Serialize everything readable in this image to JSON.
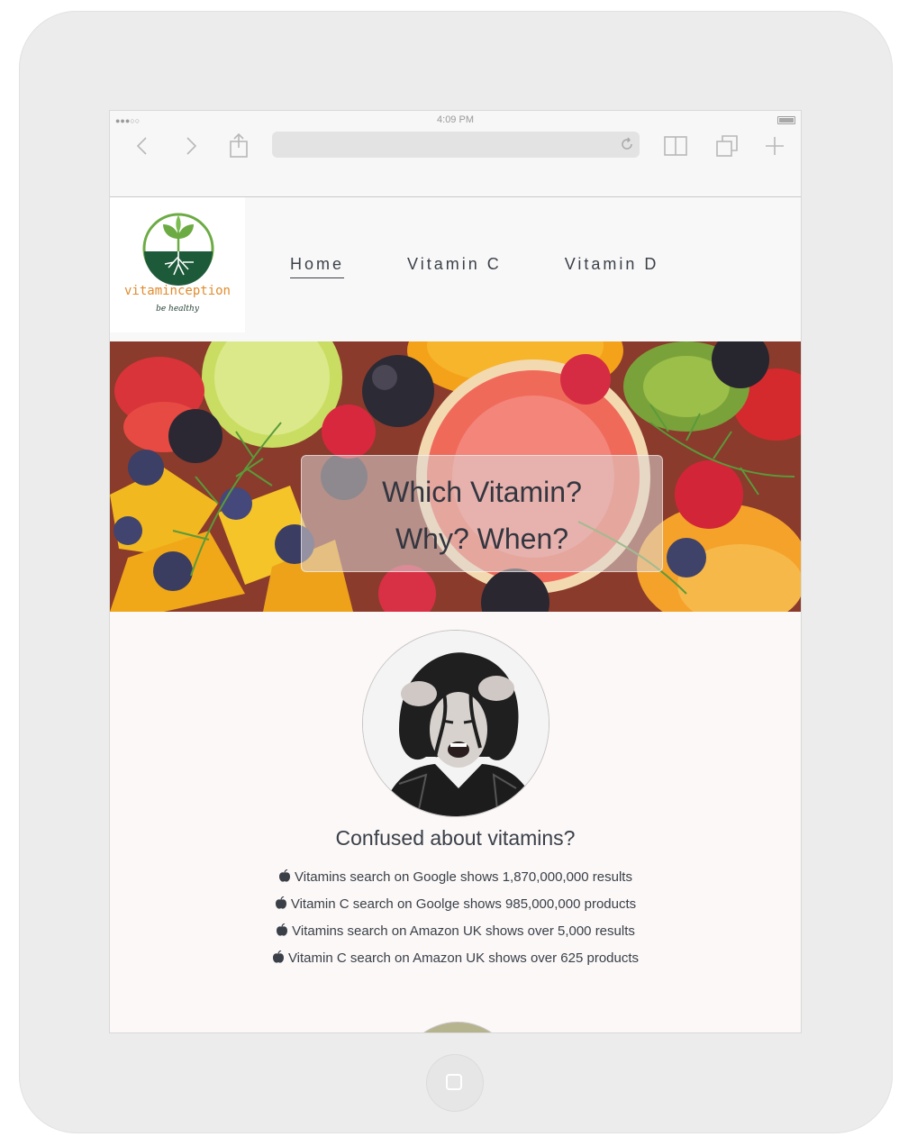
{
  "status_bar": {
    "signal": "●●●○○",
    "time": "4:09 PM"
  },
  "browser": {
    "back_icon": "chevron-left-icon",
    "forward_icon": "chevron-right-icon",
    "share_icon": "share-icon",
    "reload_icon": "reload-icon",
    "bookmarks_icon": "book-icon",
    "tabs_icon": "tabs-icon",
    "new_tab_icon": "plus-icon",
    "url": ""
  },
  "site": {
    "logo": {
      "wordmark": "vitaminception",
      "tagline": "be healthy"
    },
    "nav": [
      {
        "label": "Home",
        "active": true
      },
      {
        "label": "Vitamin C",
        "active": false
      },
      {
        "label": "Vitamin D",
        "active": false
      }
    ],
    "hero": {
      "line1": "Which Vitamin?",
      "line2": "Why? When?"
    },
    "section": {
      "title": "Confused about vitamins?",
      "facts": [
        "Vitamins search on Google shows 1,870,000,000 results",
        "Vitamin C search on Goolge shows 985,000,000 products",
        "Vitamins search on Amazon UK shows over 5,000 results",
        "Vitamin C search on Amazon UK shows over 625 products"
      ],
      "fact_icon": "apple-icon"
    }
  },
  "colors": {
    "nav_text": "#3b4049",
    "logo_orange": "#e08c2e",
    "logo_green": "#1d5a3a",
    "page_bg": "#fbf8f7"
  }
}
